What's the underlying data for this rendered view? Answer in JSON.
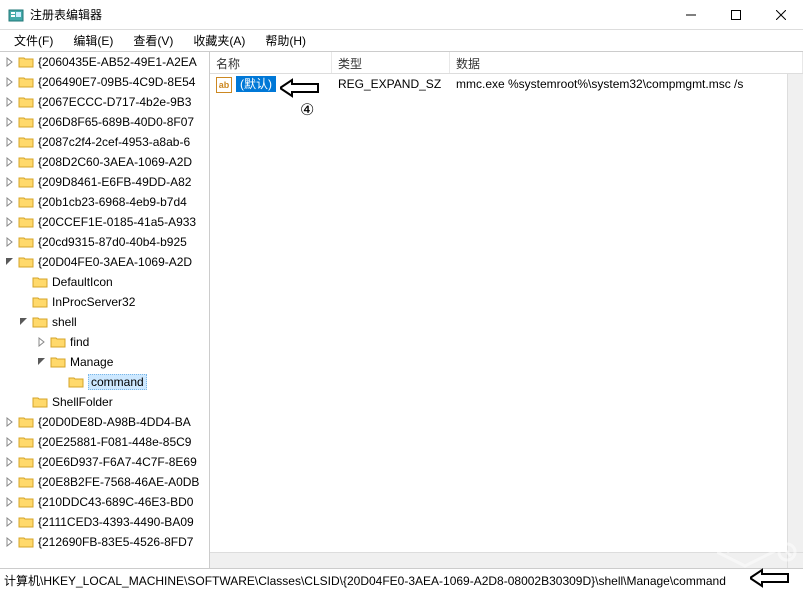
{
  "window": {
    "title": "注册表编辑器"
  },
  "menu": {
    "file": "文件(F)",
    "edit": "编辑(E)",
    "view": "查看(V)",
    "favorites": "收藏夹(A)",
    "help": "帮助(H)"
  },
  "tree": {
    "nodes": [
      {
        "label": "{2060435E-AB52-49E1-A2EA",
        "level": 1,
        "expandable": true
      },
      {
        "label": "{206490E7-09B5-4C9D-8E54",
        "level": 1,
        "expandable": true
      },
      {
        "label": "{2067ECCC-D717-4b2e-9B3",
        "level": 1,
        "expandable": true
      },
      {
        "label": "{206D8F65-689B-40D0-8F07",
        "level": 1,
        "expandable": true
      },
      {
        "label": "{2087c2f4-2cef-4953-a8ab-6",
        "level": 1,
        "expandable": true
      },
      {
        "label": "{208D2C60-3AEA-1069-A2D",
        "level": 1,
        "expandable": true
      },
      {
        "label": "{209D8461-E6FB-49DD-A82",
        "level": 1,
        "expandable": true
      },
      {
        "label": "{20b1cb23-6968-4eb9-b7d4",
        "level": 1,
        "expandable": true
      },
      {
        "label": "{20CCEF1E-0185-41a5-A933",
        "level": 1,
        "expandable": true
      },
      {
        "label": "{20cd9315-87d0-40b4-b925",
        "level": 1,
        "expandable": true
      },
      {
        "label": "{20D04FE0-3AEA-1069-A2D",
        "level": 1,
        "expanded": true,
        "expandable": true
      },
      {
        "label": "DefaultIcon",
        "level": 2,
        "expandable": false
      },
      {
        "label": "InProcServer32",
        "level": 2,
        "expandable": false
      },
      {
        "label": "shell",
        "level": 2,
        "expanded": true,
        "expandable": true
      },
      {
        "label": "find",
        "level": 3,
        "expandable": true
      },
      {
        "label": "Manage",
        "level": 3,
        "expanded": true,
        "expandable": true
      },
      {
        "label": "command",
        "level": 4,
        "expandable": false,
        "selected": true
      },
      {
        "label": "ShellFolder",
        "level": 2,
        "expandable": false
      },
      {
        "label": "{20D0DE8D-A98B-4DD4-BA",
        "level": 1,
        "expandable": true
      },
      {
        "label": "{20E25881-F081-448e-85C9",
        "level": 1,
        "expandable": true
      },
      {
        "label": "{20E6D937-F6A7-4C7F-8E69",
        "level": 1,
        "expandable": true
      },
      {
        "label": "{20E8B2FE-7568-46AE-A0DB",
        "level": 1,
        "expandable": true
      },
      {
        "label": "{210DDC43-689C-46E3-BD0",
        "level": 1,
        "expandable": true
      },
      {
        "label": "{2111CED3-4393-4490-BA09",
        "level": 1,
        "expandable": true
      },
      {
        "label": "{212690FB-83E5-4526-8FD7",
        "level": 1,
        "expandable": true
      }
    ]
  },
  "list": {
    "columns": {
      "name": "名称",
      "type": "类型",
      "data": "数据"
    },
    "rows": [
      {
        "icon": "ab",
        "name": "(默认)",
        "type": "REG_EXPAND_SZ",
        "data": "mmc.exe  %systemroot%\\system32\\compmgmt.msc  /s"
      }
    ]
  },
  "statusbar": {
    "path": "计算机\\HKEY_LOCAL_MACHINE\\SOFTWARE\\Classes\\CLSID\\{20D04FE0-3AEA-1069-A2D8-08002B30309D}\\shell\\Manage\\command"
  },
  "annotations": {
    "step4": "④"
  }
}
